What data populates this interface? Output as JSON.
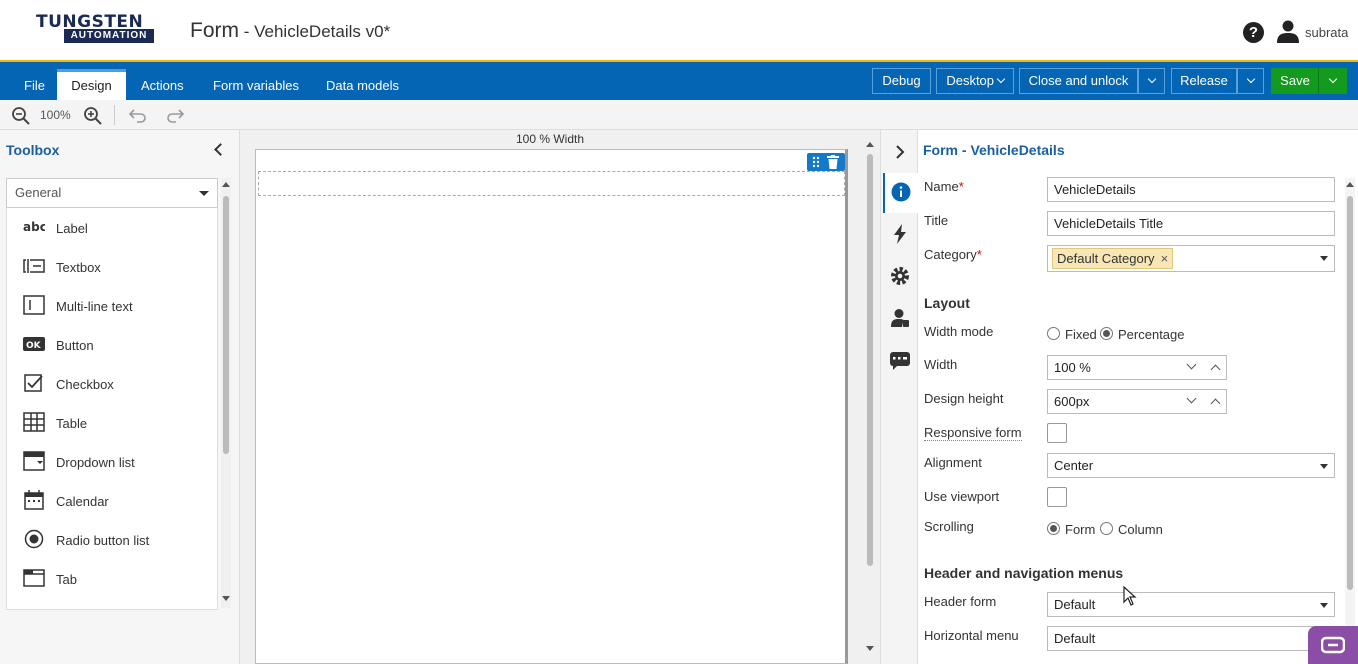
{
  "header": {
    "logo_top": "TUNGSTEN",
    "logo_bottom": "AUTOMATION",
    "title": "Form",
    "subtitle": " - VehicleDetails v0*",
    "user": "subrata"
  },
  "ribbon": {
    "tabs": [
      "File",
      "Design",
      "Actions",
      "Form variables",
      "Data models"
    ],
    "active_tab": "Design",
    "debug": "Debug",
    "desktop": "Desktop",
    "close_unlock": "Close and unlock",
    "release": "Release",
    "save": "Save"
  },
  "toolbar": {
    "zoom": "100%"
  },
  "toolbox": {
    "title": "Toolbox",
    "category": "General",
    "items": [
      "Label",
      "Textbox",
      "Multi-line text",
      "Button",
      "Checkbox",
      "Table",
      "Dropdown list",
      "Calendar",
      "Radio button list",
      "Tab"
    ],
    "icons": [
      "label-icon",
      "textbox-icon",
      "multiline-text-icon",
      "button-icon",
      "checkbox-icon",
      "table-icon",
      "dropdown-list-icon",
      "calendar-icon",
      "radio-button-list-icon",
      "tab-icon"
    ]
  },
  "canvas": {
    "width_label": "100 % Width"
  },
  "properties": {
    "title": "Form - VehicleDetails",
    "name_label": "Name",
    "name_value": "VehicleDetails",
    "title_label": "Title",
    "title_value": "VehicleDetails Title",
    "category_label": "Category",
    "category_tag": "Default Category",
    "layout_heading": "Layout",
    "width_mode_label": "Width mode",
    "width_mode_options": [
      "Fixed",
      "Percentage"
    ],
    "width_mode_selected": "Percentage",
    "width_label": "Width",
    "width_value": "100 %",
    "design_height_label": "Design height",
    "design_height_value": "600px",
    "responsive_label": "Responsive form",
    "alignment_label": "Alignment",
    "alignment_value": "Center",
    "viewport_label": "Use viewport",
    "scrolling_label": "Scrolling",
    "scrolling_options": [
      "Form",
      "Column"
    ],
    "scrolling_selected": "Form",
    "header_nav_heading": "Header and navigation menus",
    "header_form_label": "Header form",
    "header_form_value": "Default",
    "horizontal_menu_label": "Horizontal menu",
    "horizontal_menu_value": "Default"
  },
  "colors": {
    "brand_blue": "#0565b5",
    "save_green": "#129b1e",
    "accent_yellow": "#f2b705",
    "title_blue": "#1a5fa0"
  }
}
